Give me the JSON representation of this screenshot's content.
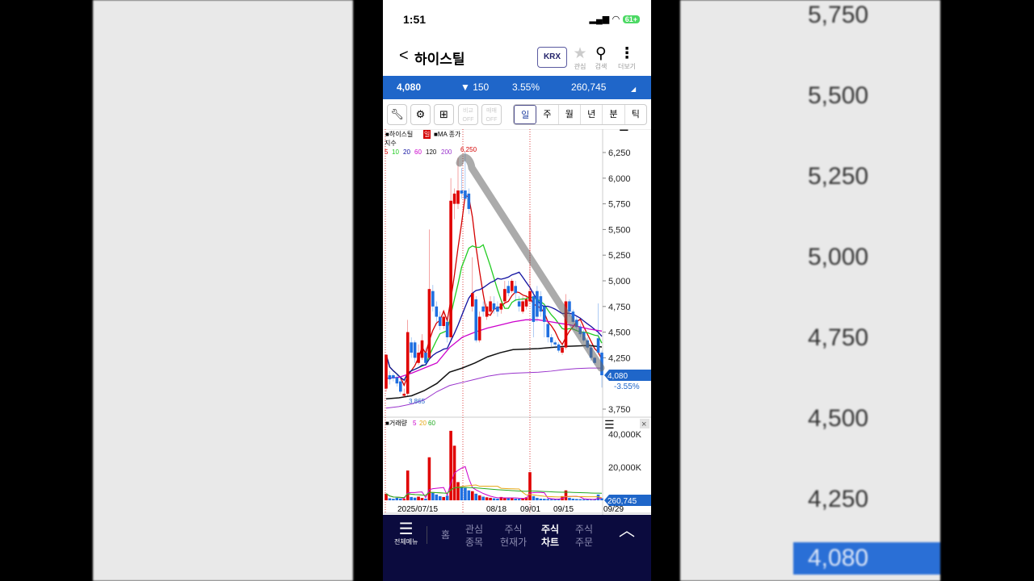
{
  "status": {
    "time": "1:51",
    "battery": "61+"
  },
  "header": {
    "back": "<",
    "title": "하이스틸",
    "exchange": "KRX",
    "fav_label": "관심",
    "search_label": "검색",
    "more_label": "더보기"
  },
  "price": {
    "last": "4,080",
    "change": "▼ 150",
    "pct": "3.55%",
    "volume": "260,745"
  },
  "toolbar": {
    "compare": "비교 OFF",
    "trade": "매매 OFF",
    "periods": [
      "일",
      "주",
      "월",
      "년",
      "분",
      "틱"
    ],
    "active": "일"
  },
  "chart_data": {
    "type": "candlestick",
    "legend": {
      "name": "■하이스틸",
      "period": "일",
      "ma_label": "■MA 종가",
      "index_label": "지수",
      "ma_periods": [
        "5",
        "10",
        "20",
        "60",
        "120",
        "200"
      ],
      "ma_colors": [
        "#d40000",
        "#22cc22",
        "#1010a0",
        "#cc00cc",
        "#111111",
        "#9933cc"
      ]
    },
    "price_ticks": [
      "6,250",
      "6,000",
      "5,750",
      "5,500",
      "5,250",
      "5,000",
      "4,750",
      "4,500",
      "4,250",
      "3,750"
    ],
    "price_tick_values": [
      6250,
      6000,
      5750,
      5500,
      5250,
      5000,
      4750,
      4500,
      4250,
      3750
    ],
    "high_label": "6,250",
    "low_label": "3,865",
    "last_label": "4,080",
    "last_pct": "-3.55%",
    "ohlc": [
      [
        3950,
        4280,
        4280,
        3920
      ],
      [
        4080,
        4040,
        4120,
        3990
      ],
      [
        4080,
        4050,
        4100,
        4020
      ],
      [
        4060,
        4000,
        4090,
        3970
      ],
      [
        4020,
        3920,
        4050,
        3900
      ],
      [
        3880,
        3900,
        3950,
        3865
      ],
      [
        3900,
        4500,
        4620,
        3880
      ],
      [
        4400,
        4300,
        4450,
        4250
      ],
      [
        4400,
        4250,
        4420,
        4200
      ],
      [
        4200,
        4300,
        4380,
        4180
      ],
      [
        4250,
        4420,
        4480,
        4230
      ],
      [
        4300,
        4200,
        4350,
        4180
      ],
      [
        4250,
        4920,
        5500,
        4230
      ],
      [
        4900,
        4750,
        4960,
        4700
      ],
      [
        4750,
        4650,
        4800,
        4600
      ],
      [
        4650,
        4560,
        4700,
        4520
      ],
      [
        4560,
        4650,
        4700,
        4530
      ],
      [
        4600,
        4450,
        4650,
        4400
      ],
      [
        4450,
        5780,
        6000,
        4430
      ],
      [
        5750,
        5850,
        5900,
        5600
      ],
      [
        5750,
        5880,
        6200,
        5700
      ],
      [
        5880,
        5850,
        6100,
        5800
      ],
      [
        5880,
        5800,
        6250,
        5780
      ],
      [
        5850,
        5700,
        5900,
        5650
      ],
      [
        4750,
        4880,
        5230,
        4700
      ],
      [
        4820,
        4420,
        4850,
        4400
      ],
      [
        4420,
        4650,
        4700,
        4400
      ],
      [
        4750,
        4700,
        4800,
        4650
      ],
      [
        4650,
        4750,
        4780,
        4620
      ],
      [
        4700,
        4800,
        4850,
        4680
      ],
      [
        4780,
        4720,
        4850,
        4680
      ],
      [
        4750,
        4700,
        4800,
        4650
      ],
      [
        4720,
        4780,
        4800,
        4680
      ],
      [
        4800,
        4920,
        5000,
        4780
      ],
      [
        4950,
        4880,
        5000,
        4850
      ],
      [
        4900,
        5000,
        5020,
        4880
      ],
      [
        4950,
        4880,
        5000,
        4800
      ],
      [
        4800,
        4750,
        4850,
        4700
      ],
      [
        4700,
        4800,
        4850,
        4680
      ],
      [
        4750,
        4820,
        4860,
        4720
      ],
      [
        4800,
        4900,
        5650,
        4780
      ],
      [
        4850,
        4600,
        4900,
        4450
      ],
      [
        4900,
        4650,
        4950,
        4600
      ],
      [
        4850,
        4700,
        4900,
        4650
      ],
      [
        4750,
        4600,
        4780,
        4450
      ],
      [
        4580,
        4450,
        4600,
        4400
      ],
      [
        4450,
        4400,
        4480,
        4350
      ],
      [
        4400,
        4380,
        4420,
        4340
      ],
      [
        4380,
        4320,
        4400,
        4300
      ],
      [
        4300,
        4350,
        4380,
        4280
      ],
      [
        4350,
        4800,
        4870,
        4330
      ],
      [
        4800,
        4700,
        4820,
        4650
      ],
      [
        4700,
        4600,
        4720,
        4580
      ],
      [
        4620,
        4550,
        4650,
        4520
      ],
      [
        4550,
        4480,
        4580,
        4450
      ],
      [
        4500,
        4420,
        4520,
        4400
      ],
      [
        4420,
        4350,
        4450,
        4330
      ],
      [
        4350,
        4250,
        4380,
        4220
      ],
      [
        4250,
        4200,
        4260,
        4180
      ],
      [
        4440,
        4300,
        4780,
        4280
      ],
      [
        4300,
        4080,
        4320,
        3960
      ]
    ],
    "ma60": [
      4050,
      4060,
      4100,
      4150,
      4200,
      4350,
      4450,
      4500,
      4540,
      4570,
      4600,
      4620,
      4620,
      4600,
      4580,
      4560,
      4530,
      4510
    ],
    "ma120": [
      3850,
      3860,
      3880,
      3930,
      4000,
      4110,
      4150,
      4200,
      4260,
      4300,
      4330,
      4335,
      4340,
      4350,
      4360,
      4365,
      4370,
      4355
    ],
    "ma200": [
      3760,
      3775,
      3800,
      3840,
      3920,
      3980,
      4010,
      4040,
      4070,
      4090,
      4100,
      4105,
      4110,
      4120,
      4135,
      4145,
      4150,
      4150
    ],
    "volume_label": "■거래량",
    "volume_ma": [
      "5",
      "20",
      "60"
    ],
    "volume_ticks": [
      "40,000K",
      "20,000K"
    ],
    "volume_tick_values": [
      40000,
      20000
    ],
    "volume_last": "260,745",
    "volume_k": [
      4000,
      1200,
      900,
      1500,
      1100,
      800,
      18000,
      2000,
      1600,
      2200,
      1400,
      1000,
      26000,
      4500,
      3500,
      2500,
      2000,
      2800,
      42000,
      33000,
      11000,
      8500,
      7500,
      6000,
      5500,
      4000,
      3000,
      2200,
      1800,
      1500,
      1200,
      1000,
      2000,
      1700,
      1500,
      1200,
      1000,
      900,
      1100,
      1800,
      17000,
      2500,
      1500,
      1000,
      900,
      800,
      700,
      600,
      800,
      2500,
      6000,
      1500,
      1000,
      800,
      700,
      600,
      500,
      400,
      600,
      3500,
      1200
    ],
    "x_labels": [
      "2025/07/15",
      "08/18",
      "09/01",
      "09/15",
      "09/29"
    ]
  },
  "background": {
    "right_ticks": [
      "5,750",
      "5,500",
      "5,250",
      "5,000",
      "4,750",
      "4,500",
      "4,250"
    ],
    "right_last": "4,080"
  },
  "nav": {
    "menu": "전체메뉴",
    "items": [
      [
        "홈"
      ],
      [
        "관심",
        "종목"
      ],
      [
        "주식",
        "현재가"
      ],
      [
        "주식",
        "차트"
      ],
      [
        "주식",
        "주문"
      ]
    ],
    "active": 3
  }
}
